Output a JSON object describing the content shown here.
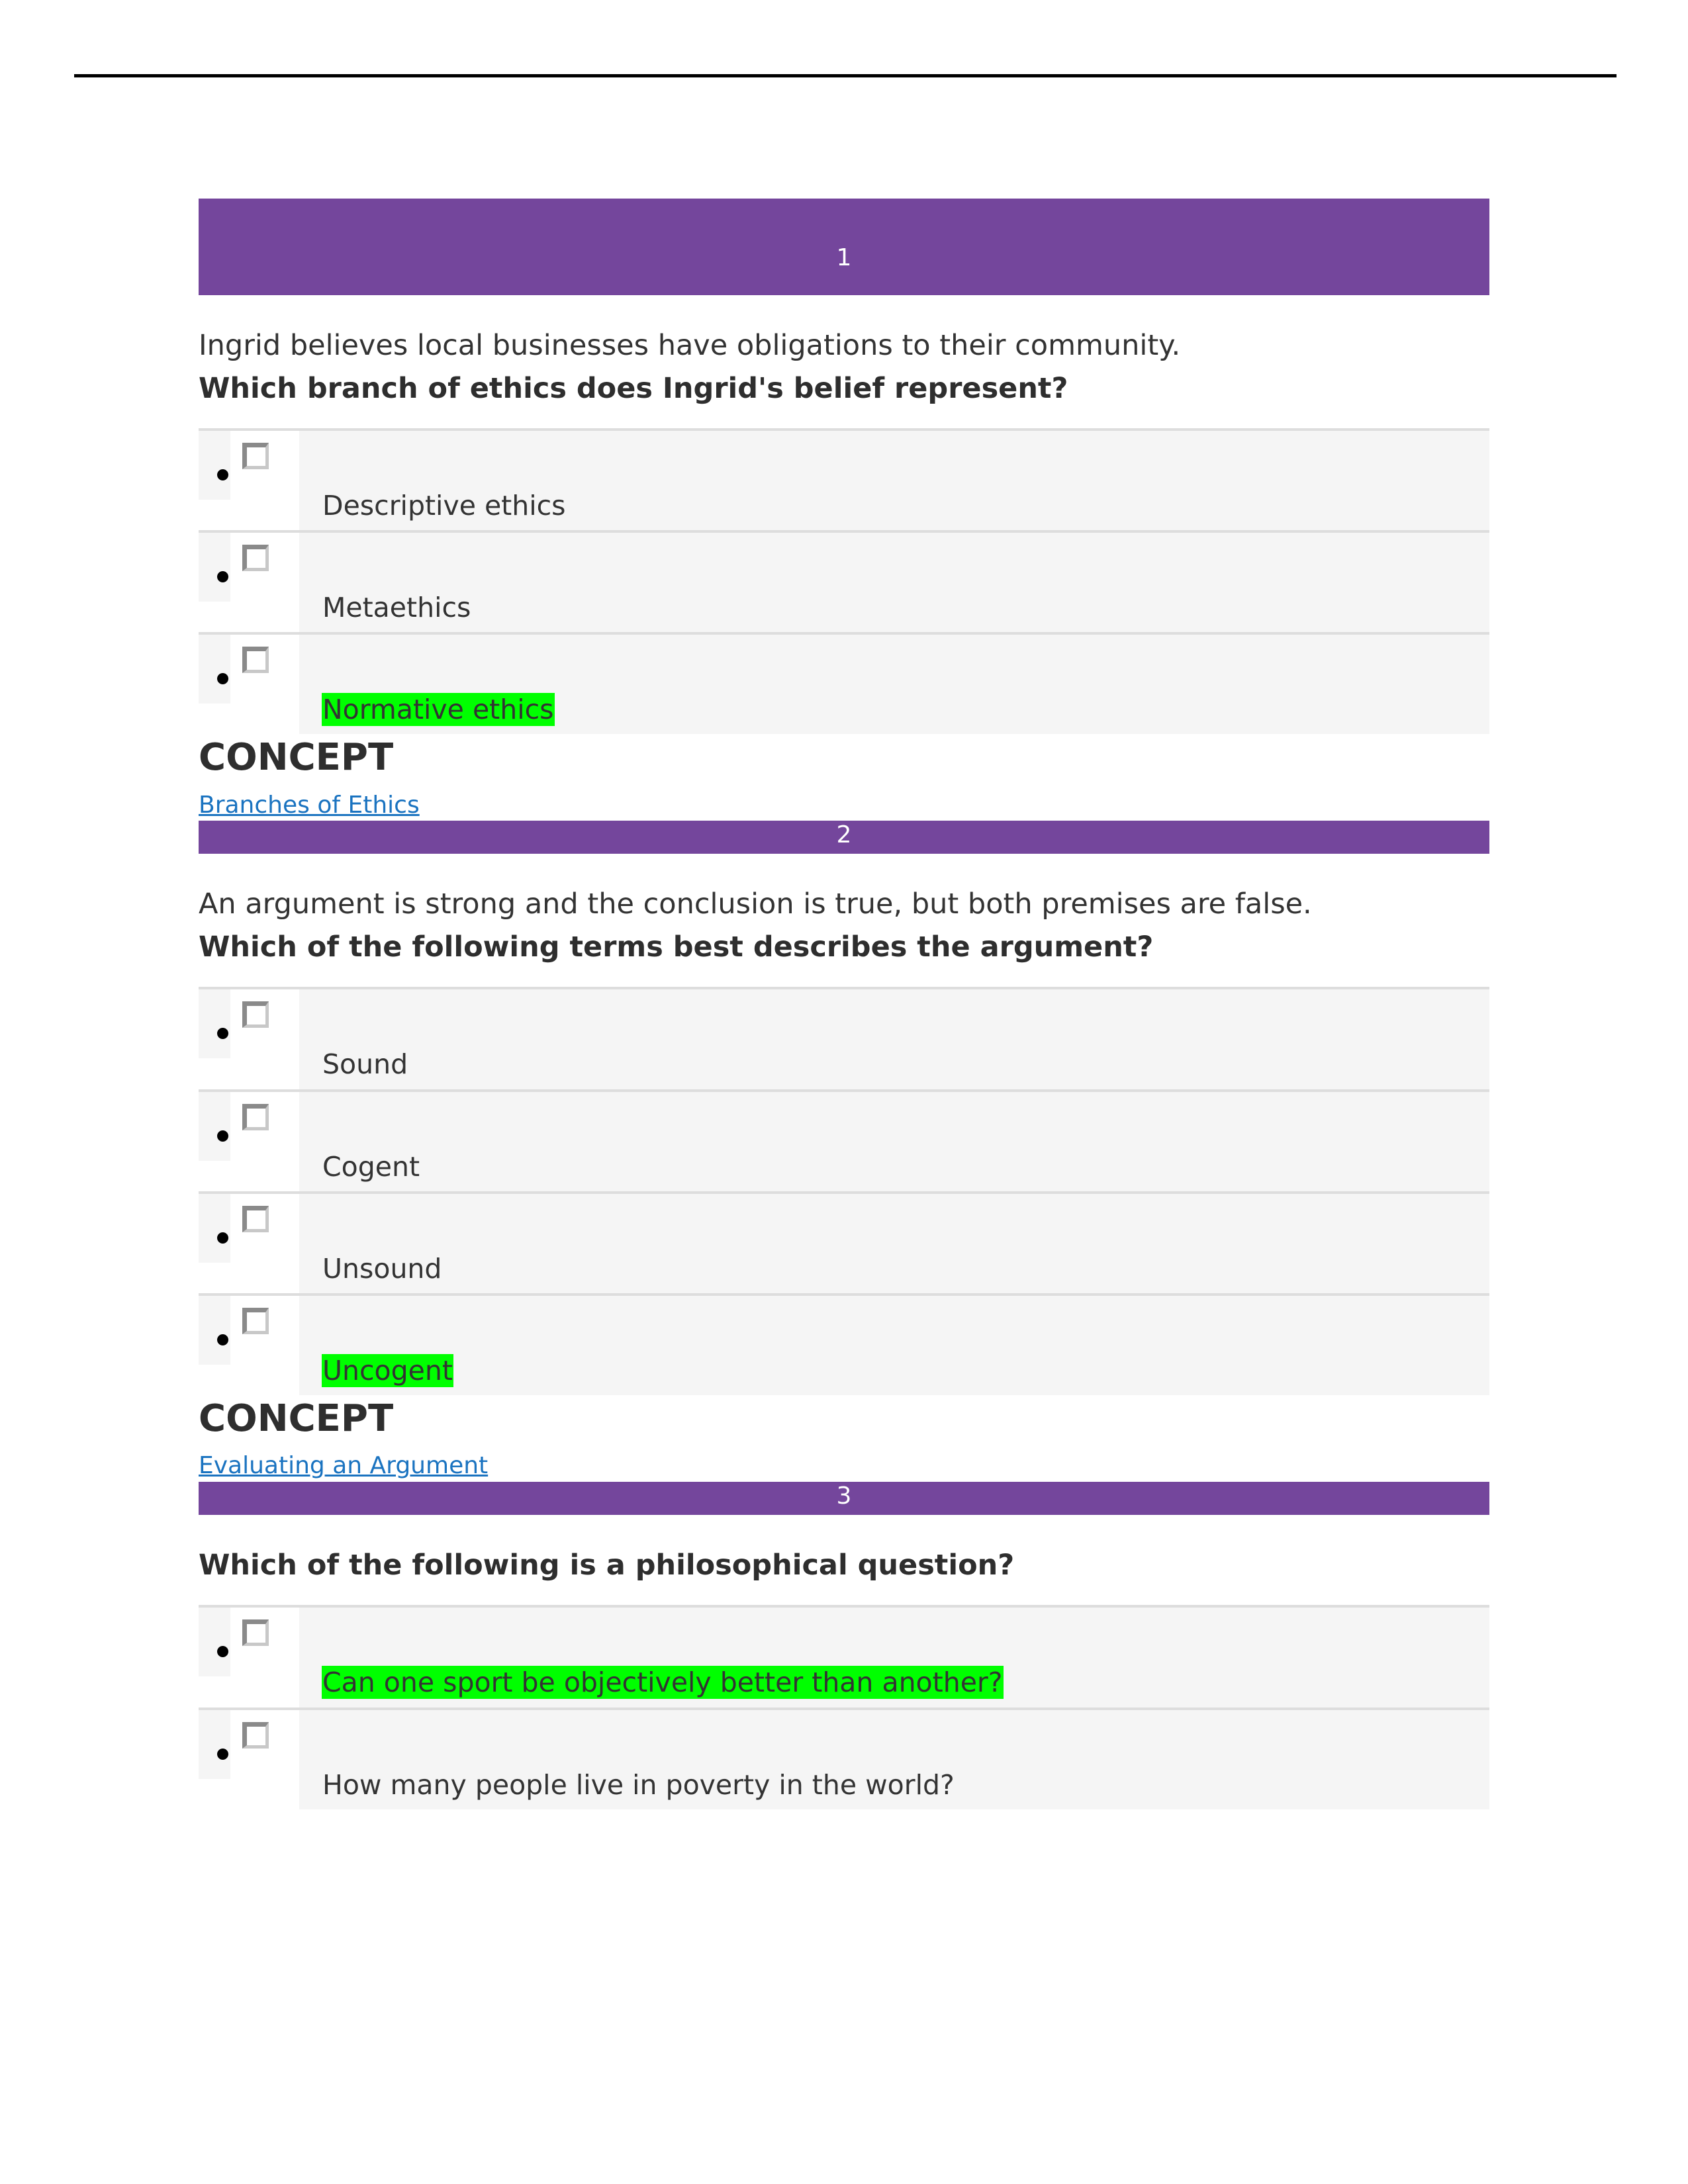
{
  "document": {
    "type": "quiz-results",
    "header_rule": true
  },
  "colors": {
    "question_bar": "#74469C",
    "question_bar_text": "#FFFFFF",
    "option_row_bg": "#F5F5F5",
    "option_row_border": "#DDDDDD",
    "correct_highlight": "#00FF00",
    "link": "#1A73C0",
    "body_text": "#333333",
    "heading_text": "#2E2E2E"
  },
  "labels": {
    "concept_heading": "CONCEPT"
  },
  "questions": [
    {
      "number": "1",
      "stem": "Ingrid believes local businesses have obligations to their community.",
      "prompt": "Which branch of ethics does Ingrid's belief represent?",
      "options": [
        {
          "label": "Descriptive ethics",
          "correct": false,
          "checked": false
        },
        {
          "label": "Metaethics",
          "correct": false,
          "checked": false
        },
        {
          "label": "Normative ethics",
          "correct": true,
          "checked": false
        }
      ],
      "concept_heading": "CONCEPT",
      "concept_link": "Branches of Ethics"
    },
    {
      "number": "2",
      "stem": "An argument is strong and the conclusion is true, but both premises are false.",
      "prompt": "Which of the following terms best describes the argument?",
      "options": [
        {
          "label": "Sound",
          "correct": false,
          "checked": false
        },
        {
          "label": "Cogent",
          "correct": false,
          "checked": false
        },
        {
          "label": "Unsound",
          "correct": false,
          "checked": false
        },
        {
          "label": "Uncogent",
          "correct": true,
          "checked": false
        }
      ],
      "concept_heading": "CONCEPT",
      "concept_link": "Evaluating an Argument"
    },
    {
      "number": "3",
      "stem": "",
      "prompt": "Which of the following is a philosophical question?",
      "options": [
        {
          "label": "Can one sport be objectively better than another?",
          "correct": true,
          "checked": false
        },
        {
          "label": "How many people live in poverty in the world?",
          "correct": false,
          "checked": false
        }
      ],
      "concept_heading": "",
      "concept_link": ""
    }
  ]
}
